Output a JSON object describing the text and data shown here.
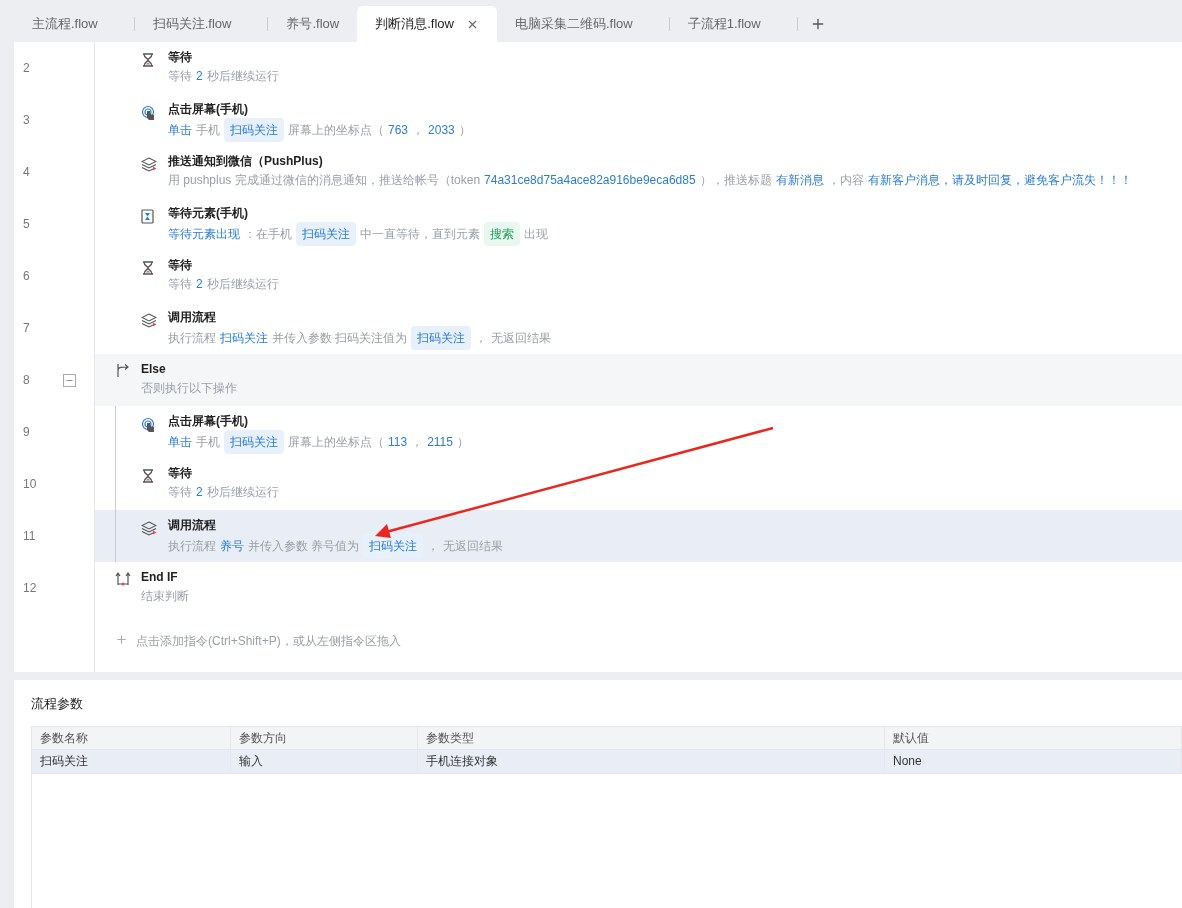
{
  "tabs": [
    {
      "label": "主流程.flow",
      "selected": false
    },
    {
      "label": "扫码关注.flow",
      "selected": false
    },
    {
      "label": "养号.flow",
      "selected": false
    },
    {
      "label": "判断消息.flow",
      "selected": true
    },
    {
      "label": "电脑采集二维码.flow",
      "selected": false
    },
    {
      "label": "子流程1.flow",
      "selected": false
    }
  ],
  "blocks": [
    {
      "kind": "body",
      "children": [
        {
          "line": "2",
          "kind": "wait",
          "title": "等待",
          "selected": false,
          "segments": [
            {
              "kind": "text",
              "text": "等待"
            },
            {
              "kind": "value",
              "text": "2"
            },
            {
              "kind": "text",
              "text": "秒后继续运行"
            }
          ]
        },
        {
          "line": "3",
          "kind": "tap",
          "title": "点击屏幕(手机)",
          "selected": false,
          "segments": [
            {
              "kind": "value",
              "text": "单击"
            },
            {
              "kind": "text",
              "text": "手机"
            },
            {
              "kind": "tag",
              "text": "扫码关注"
            },
            {
              "kind": "text",
              "text": "屏幕上的坐标点（"
            },
            {
              "kind": "value",
              "text": "763"
            },
            {
              "kind": "text",
              "text": "，"
            },
            {
              "kind": "value",
              "text": "2033"
            },
            {
              "kind": "text",
              "text": "）"
            }
          ]
        },
        {
          "line": "4",
          "kind": "push",
          "title": "推送通知到微信（PushPlus)",
          "selected": false,
          "segments": [
            {
              "kind": "text",
              "text": "用 pushplus 完成通过微信的消息通知，推送给帐号（token"
            },
            {
              "kind": "value",
              "text": "74a31ce8d75a4ace82a916be9eca6d85"
            },
            {
              "kind": "text",
              "text": "），推送标题"
            },
            {
              "kind": "value",
              "text": "有新消息"
            },
            {
              "kind": "text",
              "text": "，内容"
            },
            {
              "kind": "value",
              "text": "有新客户消息，请及时回复，避免客户流失！！！"
            }
          ]
        },
        {
          "line": "5",
          "kind": "wait_element",
          "title": "等待元素(手机)",
          "selected": false,
          "segments": [
            {
              "kind": "value",
              "text": "等待元素出现"
            },
            {
              "kind": "text",
              "text": "：在手机"
            },
            {
              "kind": "tag",
              "text": "扫码关注"
            },
            {
              "kind": "text",
              "text": "中一直等待，直到元素"
            },
            {
              "kind": "tag_green",
              "text": "搜索"
            },
            {
              "kind": "text",
              "text": "出现"
            }
          ]
        },
        {
          "line": "6",
          "kind": "wait",
          "title": "等待",
          "selected": false,
          "segments": [
            {
              "kind": "text",
              "text": "等待"
            },
            {
              "kind": "value",
              "text": "2"
            },
            {
              "kind": "text",
              "text": "秒后继续运行"
            }
          ]
        },
        {
          "line": "7",
          "kind": "call",
          "title": "调用流程",
          "selected": false,
          "segments": [
            {
              "kind": "text",
              "text": "执行流程"
            },
            {
              "kind": "value",
              "text": "扫码关注"
            },
            {
              "kind": "text",
              "text": "并传入参数 扫码关注值为"
            },
            {
              "kind": "tag",
              "text": "扫码关注"
            },
            {
              "kind": "text",
              "text": "，  无返回结果"
            }
          ]
        }
      ]
    },
    {
      "kind": "else",
      "line": "8",
      "title": "Else",
      "subtitle": "否则执行以下操作",
      "expanded": true,
      "children": [
        {
          "line": "9",
          "kind": "tap",
          "title": "点击屏幕(手机)",
          "selected": false,
          "segments": [
            {
              "kind": "value",
              "text": "单击"
            },
            {
              "kind": "text",
              "text": "手机"
            },
            {
              "kind": "tag",
              "text": "扫码关注"
            },
            {
              "kind": "text",
              "text": "屏幕上的坐标点（"
            },
            {
              "kind": "value",
              "text": "113"
            },
            {
              "kind": "text",
              "text": "，"
            },
            {
              "kind": "value",
              "text": "2115"
            },
            {
              "kind": "text",
              "text": "）"
            }
          ]
        },
        {
          "line": "10",
          "kind": "wait",
          "title": "等待",
          "selected": false,
          "segments": [
            {
              "kind": "text",
              "text": "等待"
            },
            {
              "kind": "value",
              "text": "2"
            },
            {
              "kind": "text",
              "text": "秒后继续运行"
            }
          ]
        },
        {
          "line": "11",
          "kind": "call",
          "title": "调用流程",
          "selected": true,
          "segments": [
            {
              "kind": "text",
              "text": "执行流程"
            },
            {
              "kind": "value",
              "text": "养号"
            },
            {
              "kind": "text",
              "text": "并传入参数 养号值为"
            },
            {
              "kind": "tag",
              "text": "扫码关注"
            },
            {
              "kind": "text",
              "text": "，  无返回结果"
            }
          ]
        }
      ]
    },
    {
      "kind": "endif",
      "line": "12",
      "title": "End IF",
      "subtitle": "结束判断"
    }
  ],
  "add_hint": "点击添加指令(Ctrl+Shift+P)，或从左侧指令区拖入",
  "params": {
    "title": "流程参数",
    "columns": [
      "参数名称",
      "参数方向",
      "参数类型",
      "默认值"
    ],
    "rows": [
      {
        "selected": true,
        "cells": [
          "扫码关注",
          "输入",
          "手机连接对象",
          "None"
        ]
      }
    ]
  }
}
